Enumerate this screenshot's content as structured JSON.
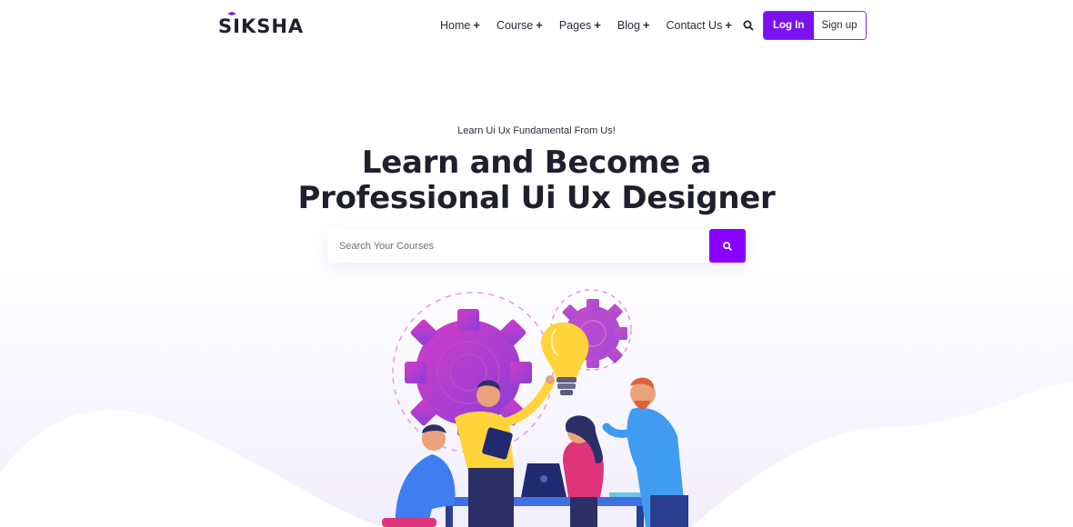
{
  "brand": {
    "logo_text": "SIKSHA"
  },
  "nav": {
    "items": [
      {
        "label": "Home",
        "icon": "plus-icon"
      },
      {
        "label": "Course",
        "icon": "plus-icon"
      },
      {
        "label": "Pages",
        "icon": "plus-icon"
      },
      {
        "label": "Blog",
        "icon": "plus-icon"
      },
      {
        "label": "Contact Us",
        "icon": "plus-icon"
      }
    ],
    "expand_symbol": "+"
  },
  "header": {
    "search_icon": "search-icon",
    "login_label": "Log In",
    "signup_label": "Sign up"
  },
  "hero": {
    "tagline": "Learn Ui Ux Fundamental From Us!",
    "headline": "Learn and Become a Professional Ui Ux Designer",
    "search": {
      "placeholder": "Search Your Courses",
      "value": "",
      "submit_icon": "search-icon"
    }
  },
  "colors": {
    "accent": "#7b12ee",
    "accent_button": "#8a00ff",
    "gear": "#c03ad0",
    "bulb": "#ffd43a",
    "background_wave": "#f4f2fd"
  }
}
